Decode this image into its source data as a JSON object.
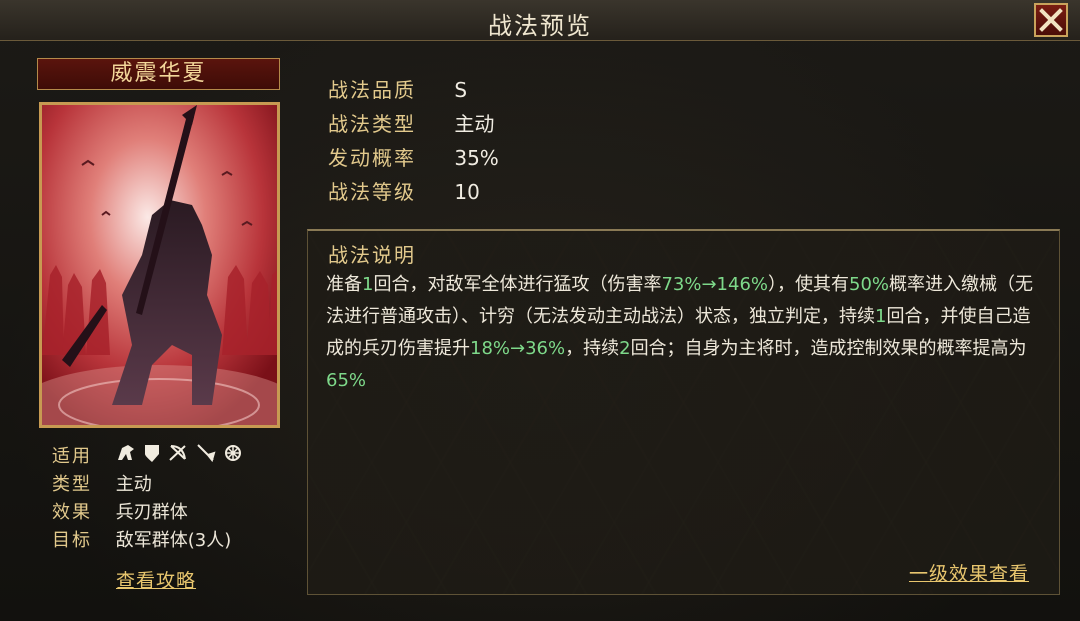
{
  "header": {
    "title": "战法预览",
    "close_icon": "close-icon"
  },
  "tactic": {
    "name": "威震华夏"
  },
  "side_info": {
    "applicable_label": "适用",
    "applicable_icons": [
      "cavalry-icon",
      "shield-icon",
      "archer-icon",
      "spear-icon",
      "siege-icon"
    ],
    "type_label": "类型",
    "type_value": "主动",
    "effect_label": "效果",
    "effect_value": "兵刃群体",
    "target_label": "目标",
    "target_value": "敌军群体(3人)"
  },
  "guide_link": "查看攻略",
  "stats": [
    {
      "label": "战法品质",
      "value": "S"
    },
    {
      "label": "战法类型",
      "value": "主动"
    },
    {
      "label": "发动概率",
      "value": "35%"
    },
    {
      "label": "战法等级",
      "value": "10"
    }
  ],
  "description": {
    "title": "战法说明",
    "segments": [
      {
        "text": "准备"
      },
      {
        "text": "1",
        "hl": true
      },
      {
        "text": "回合，对敌军全体进行猛攻（伤害率"
      },
      {
        "text": "73%→146%",
        "hl": true
      },
      {
        "text": "），使其有"
      },
      {
        "text": "50%",
        "hl": true
      },
      {
        "text": "概率进入缴械（无法进行普通攻击）、计穷（无法发动主动战法）状态，独立判定，持续"
      },
      {
        "text": "1",
        "hl": true
      },
      {
        "text": "回合，并使自己造成的兵刃伤害提升"
      },
      {
        "text": "18%→36%",
        "hl": true
      },
      {
        "text": "，持续"
      },
      {
        "text": "2",
        "hl": true
      },
      {
        "text": "回合；自身为主将时，造成控制效果的概率提高为"
      },
      {
        "text": "65%",
        "hl": true
      }
    ]
  },
  "effect_link": "一级效果查看",
  "colors": {
    "highlight": "#7ed98a",
    "label_gold": "#e2c98c",
    "link_gold": "#e8c66e"
  }
}
